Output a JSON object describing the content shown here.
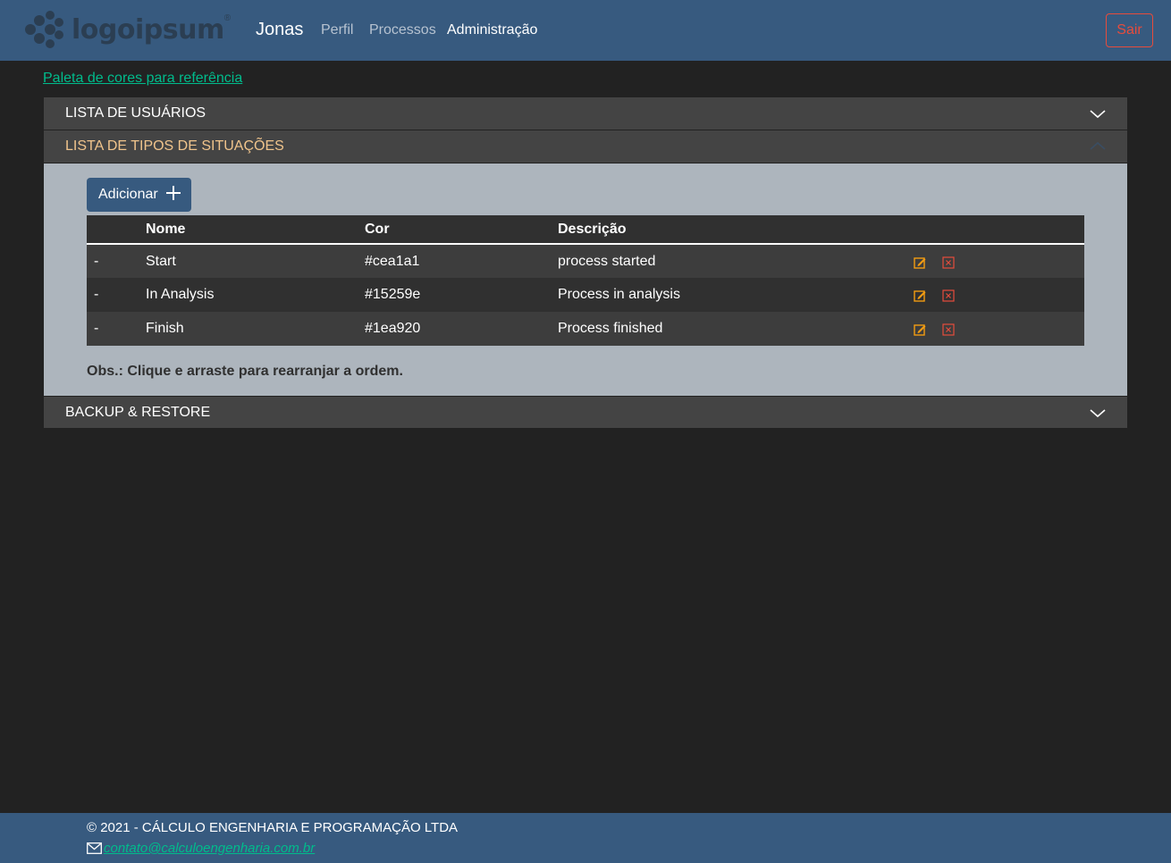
{
  "navbar": {
    "logo_text": "logoipsum",
    "logo_tm": "®",
    "username": "Jonas",
    "links": [
      {
        "label": "Perfil",
        "active": false
      },
      {
        "label": "Processos",
        "active": false
      },
      {
        "label": "Administração",
        "active": true
      }
    ],
    "logout_label": "Sair"
  },
  "palette_link": "Paleta de cores para referência",
  "accordion": {
    "sections": [
      {
        "title": "LISTA DE USUÁRIOS",
        "expanded": false
      },
      {
        "title": "LISTA DE TIPOS DE SITUAÇÕES",
        "expanded": true
      },
      {
        "title": "BACKUP & RESTORE",
        "expanded": false
      }
    ]
  },
  "situations": {
    "add_label": "Adicionar",
    "columns": [
      "",
      "Nome",
      "Cor",
      "Descrição",
      ""
    ],
    "rows": [
      {
        "drag": "-",
        "nome": "Start",
        "cor": "#cea1a1",
        "descricao": "process started"
      },
      {
        "drag": "-",
        "nome": "In Analysis",
        "cor": "#15259e",
        "descricao": "Process in analysis"
      },
      {
        "drag": "-",
        "nome": "Finish",
        "cor": "#1ea920",
        "descricao": "Process finished"
      }
    ],
    "note": "Obs.: Clique e arraste para rearranjar a ordem."
  },
  "footer": {
    "copyright": "© 2021 - CÁLCULO ENGENHARIA E PROGRAMAÇÃO LTDA",
    "email": "contato@calculoengenharia.com.br"
  },
  "icons": {
    "edit": "edit-icon",
    "delete": "delete-icon",
    "mail": "envelope-icon",
    "chevron_down": "chevron-down-icon",
    "chevron_up": "chevron-up-icon",
    "plus": "plus-icon"
  },
  "colors": {
    "primary": "#375a7f",
    "background": "#222222",
    "accent_link": "#00bc8c",
    "danger": "#e74c3c",
    "warning": "#f39c12",
    "open_header_text": "#f0c48c"
  }
}
